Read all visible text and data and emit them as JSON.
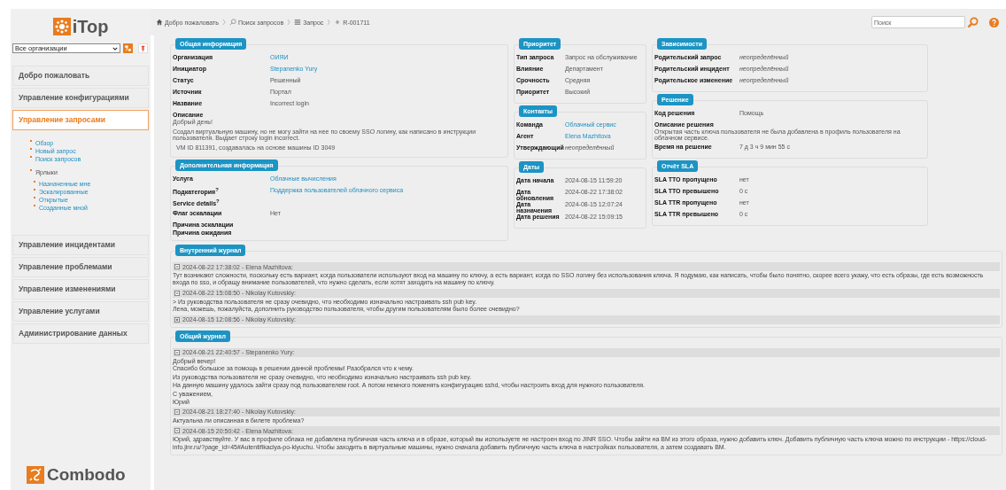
{
  "logo": "iTop",
  "org_filter": {
    "value": "Все организации"
  },
  "menu": [
    {
      "label": "Добро пожаловать",
      "selected": false
    },
    {
      "label": "Управление конфигурациями",
      "selected": false
    },
    {
      "label": "Управление запросами",
      "selected": true,
      "items": [
        {
          "label": "Обзор",
          "kind": "link"
        },
        {
          "label": "Новый запрос",
          "kind": "link"
        },
        {
          "label": "Поиск запросов",
          "kind": "link"
        },
        {
          "label": "Ярлыки",
          "kind": "heading",
          "children": [
            {
              "label": "Назначенные мне"
            },
            {
              "label": "Эскалированные"
            },
            {
              "label": "Открытые"
            },
            {
              "label": "Созданные мной"
            }
          ]
        }
      ]
    },
    {
      "label": "Управление инцидентами",
      "selected": false
    },
    {
      "label": "Управление проблемами",
      "selected": false
    },
    {
      "label": "Управление изменениями",
      "selected": false
    },
    {
      "label": "Управление услугами",
      "selected": false
    },
    {
      "label": "Администрирование данных",
      "selected": false
    }
  ],
  "footer_logo": "Combodo",
  "breadcrumb": [
    {
      "label": "Добро пожаловать",
      "kind": "home"
    },
    {
      "label": "Поиск запросов",
      "kind": "search"
    },
    {
      "label": "Запрос",
      "kind": "list"
    },
    {
      "label": "R-001711",
      "kind": "object"
    }
  ],
  "search": {
    "placeholder": "Поиск"
  },
  "columns": [
    [
      {
        "title": "Общая информация",
        "fields": [
          {
            "label": "Организация",
            "value": "ОИЯИ",
            "kind": "link"
          },
          {
            "label": "Инициатор",
            "value": "Stepanenko Yury",
            "kind": "link"
          },
          {
            "label": "Статус",
            "value": "Решенный",
            "kind": "text"
          },
          {
            "label": "Источник",
            "value": "Портал",
            "kind": "text"
          },
          {
            "label": "Название",
            "value": "Incorrect login",
            "kind": "text"
          },
          {
            "label": "Описание",
            "kind": "block",
            "paragraphs": [
              "Добрый день!",
              "Создал виртуальную машину, но не могу зайти на нее по своему  SSO логину, как написано в инструкции пользователя. Выдает строку login incorrect.",
              "VM ID 811391, создавалась на основе машины ID 3049"
            ]
          }
        ]
      },
      {
        "title": "Дополнительная информация",
        "fields": [
          {
            "label": "Услуга",
            "value": "Облачные вычисления",
            "kind": "link"
          },
          {
            "label": "Подкатегория$^{?}$",
            "value": "Поддержка пользователей облачного сервиса",
            "kind": "link"
          },
          {
            "label": "Service details$^{?}$",
            "kind": "text"
          },
          {
            "label": "Флаг эскалации",
            "value": "Нет",
            "kind": "text"
          },
          {
            "label": "Причина эскалации",
            "kind": "tight"
          },
          {
            "label": "Причина ожидания",
            "kind": "tight"
          }
        ]
      }
    ],
    [
      {
        "title": "Приоритет",
        "fields": [
          {
            "label": "Тип запроса",
            "value": "Запрос на обслуживание",
            "kind": "text"
          },
          {
            "label": "Влияние",
            "value": "Департамент",
            "kind": "text"
          },
          {
            "label": "Срочность",
            "value": "Средняя",
            "kind": "text"
          },
          {
            "label": "Приоритет",
            "value": "Высокий",
            "kind": "text"
          }
        ]
      },
      {
        "title": "Контакты",
        "fields": [
          {
            "label": "Команда",
            "value": "Облачный сервис",
            "kind": "link"
          },
          {
            "label": "Агент",
            "value": "Elena Mazhitova",
            "kind": "link"
          },
          {
            "label": "Утверждающий",
            "value": "неопределённый",
            "kind": "empty"
          }
        ]
      },
      {
        "title": "Даты",
        "fields": [
          {
            "label": "Дата начала",
            "value": "2024-08-15 11:59:20",
            "kind": "text"
          },
          {
            "label": "Дата обновления",
            "value": "2024-08-22 17:38:02",
            "kind": "text"
          },
          {
            "label": "Дата назначения",
            "value": "2024-08-15 12:07:24",
            "kind": "text"
          },
          {
            "label": "Дата решения",
            "value": "2024-08-22 15:09:15",
            "kind": "text"
          }
        ]
      }
    ],
    [
      {
        "title": "Зависимости",
        "fields": [
          {
            "label": "Родительский запрос",
            "value": "неопределённый",
            "kind": "empty"
          },
          {
            "label": "Родительский инцидент",
            "value": "неопределённый",
            "kind": "empty"
          },
          {
            "label": "Родительское изменение",
            "value": "неопределённый",
            "kind": "empty"
          }
        ]
      },
      {
        "title": "Решение",
        "fields": [
          {
            "label": "Код решения",
            "value": "Помощь",
            "kind": "text"
          },
          {
            "label": "Описание решения",
            "kind": "block",
            "paragraphs": [
              "Открытая часть ключа пользователя не была добавлена в профиль пользователя на облачном сервисе."
            ]
          },
          {
            "label": "Время на решение",
            "value": "7 д 3 ч 9 мин 55 с",
            "kind": "text"
          }
        ]
      },
      {
        "title": "Отчёт SLA",
        "fields": [
          {
            "label": "SLA TTO пропущено",
            "value": "нет",
            "kind": "text"
          },
          {
            "label": "SLA TTO превышено",
            "value": "0 с",
            "kind": "text"
          },
          {
            "label": "SLA TTR пропущено",
            "value": "нет",
            "kind": "text"
          },
          {
            "label": "SLA TTR превышено",
            "value": "0 с",
            "kind": "text"
          }
        ]
      }
    ]
  ],
  "journals": [
    {
      "title": "Внутренний журнал",
      "entries": [
        {
          "header": "2024-08-22 17:38:02 - Elena Mazhitova:",
          "expanded": true,
          "paragraphs": [
            [
              "Тут возникают сложности, поскольку есть вариант, когда пользователи используют вход на машину по ключу, а есть вариант, когда по SSO логину без использования ключа. Я подумаю, как написать, чтобы было понятно, скорее всего укажу, что есть образы, где есть возможность входа по sso, и обращу внимание пользователей, что нужно сделать, если хотят заходить на машину по ключу."
            ]
          ]
        },
        {
          "header": "2024-08-22 15:08:50 - Nikolay Kutovskiy:",
          "expanded": true,
          "paragraphs": [
            [
              "> Из руководства пользователя не сразу очевидно, что необходимо изначально настраивать ssh pub key.",
              "Лена, можешь, пожалуйста, дополнить руководство пользователя, чтобы другим пользователям было более очевидно?"
            ]
          ]
        },
        {
          "header": "2024-08-15 12:08:56 - Nikolay Kutovskiy:",
          "expanded": false
        }
      ]
    },
    {
      "title": "Общий журнал",
      "entries": [
        {
          "header": "2024-08-21 22:40:57 - Stepanenko Yury:",
          "expanded": true,
          "paragraphs": [
            [
              "Добрый вечер!",
              "Спасибо большое за помощь в решении данной проблемы! Разобрался что к чему."
            ],
            [
              "Из руководства пользователя не сразу очевидно, что необходимо изначально настраивать ssh pub key.",
              "На данную машину удалось зайти сразу под пользователем root. А потом немного поменять конфигурацию sshd, чтобы настроить вход для нужного пользователя."
            ],
            [
              "С уважением,",
              "Юрий"
            ]
          ]
        },
        {
          "header": "2024-08-21 18:27:40 - Nikolay Kutovskiy:",
          "expanded": true,
          "paragraphs": [
            [
              "Актуальна ли описанная в билете проблема?"
            ]
          ]
        },
        {
          "header": "2024-08-15 20:50:42 - Elena Mazhitova:",
          "expanded": true,
          "paragraphs": [
            [
              "Юрий, здравствуйте. У вас в профиле облака не добавлена публичная часть ключа и в образе, который вы используете не настроен вход по JINR SSO. Чтобы зайти на ВМ из этого образа, нужно добавить ключ. Добавить публичную часть ключа можно по инструкции - https://cloud-info.jinr.ru/?page_id=45#Autentifikaciya-po-klyuchu. Чтобы заходить в  виртуальные машины, нужно сначала добавить публичную часть ключа в настройках пользователя, а затем создавать ВМ."
            ]
          ]
        }
      ]
    }
  ]
}
